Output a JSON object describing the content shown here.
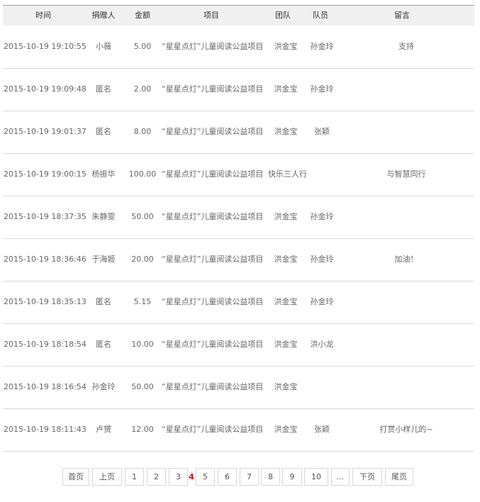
{
  "table": {
    "headers": {
      "time": "时间",
      "donor": "捐赠人",
      "amount": "金额",
      "project": "项目",
      "team": "团队",
      "member": "队员",
      "message": "留言"
    },
    "rows": [
      {
        "time": "2015-10-19 19:10:55",
        "donor": "小薇",
        "amount": "5.00",
        "project": "“星星点灯”儿童阅读公益项目",
        "team": "洪金宝",
        "member": "孙金玲",
        "message": "支持"
      },
      {
        "time": "2015-10-19 19:09:48",
        "donor": "匿名",
        "amount": "2.00",
        "project": "“星星点灯”儿童阅读公益项目",
        "team": "洪金宝",
        "member": "孙金玲",
        "message": ""
      },
      {
        "time": "2015-10-19 19:01:37",
        "donor": "匿名",
        "amount": "8.00",
        "project": "“星星点灯”儿童阅读公益项目",
        "team": "洪金宝",
        "member": "张颖",
        "message": ""
      },
      {
        "time": "2015-10-19 19:00:15",
        "donor": "杨振华",
        "amount": "100.00",
        "project": "“星星点灯”儿童阅读公益项目",
        "team": "快乐三人行",
        "member": "",
        "message": "与智慧同行"
      },
      {
        "time": "2015-10-19 18:37:35",
        "donor": "朱静雯",
        "amount": "50.00",
        "project": "“星星点灯”儿童阅读公益项目",
        "team": "洪金宝",
        "member": "孙金玲",
        "message": ""
      },
      {
        "time": "2015-10-19 18:36:46",
        "donor": "于海姬",
        "amount": "20.00",
        "project": "“星星点灯”儿童阅读公益项目",
        "team": "洪金宝",
        "member": "孙金玲",
        "message": "加油！"
      },
      {
        "time": "2015-10-19 18:35:13",
        "donor": "匿名",
        "amount": "5.15",
        "project": "“星星点灯”儿童阅读公益项目",
        "team": "洪金宝",
        "member": "孙金玲",
        "message": ""
      },
      {
        "time": "2015-10-19 18:18:54",
        "donor": "匿名",
        "amount": "10.00",
        "project": "“星星点灯”儿童阅读公益项目",
        "team": "洪金宝",
        "member": "洪小龙",
        "message": ""
      },
      {
        "time": "2015-10-19 18:16:54",
        "donor": "孙金玲",
        "amount": "50.00",
        "project": "“星星点灯”儿童阅读公益项目",
        "team": "洪金宝",
        "member": "",
        "message": ""
      },
      {
        "time": "2015-10-19 18:11:43",
        "donor": "卢赟",
        "amount": "12.00",
        "project": "“星星点灯”儿童阅读公益项目",
        "team": "洪金宝",
        "member": "张颖",
        "message": "打赏小样儿的~"
      }
    ]
  },
  "pagination": {
    "first": "首页",
    "prev": "上页",
    "pages": [
      "1",
      "2",
      "3"
    ],
    "current": "4",
    "pages_after": [
      "5",
      "6",
      "7",
      "8",
      "9",
      "10"
    ],
    "ellipsis": "...",
    "next": "下页",
    "last": "尾页"
  },
  "colors": {
    "current_page": "#e60012",
    "header_bg": "#f0f0f0",
    "top_border": "#7fb27f"
  }
}
